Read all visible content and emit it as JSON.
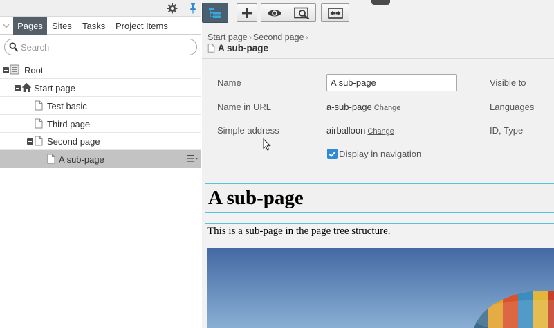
{
  "left_panel": {
    "tabs": [
      "Pages",
      "Sites",
      "Tasks",
      "Project Items"
    ],
    "search": {
      "placeholder": "Search",
      "value": ""
    },
    "tree": [
      {
        "label": "Root",
        "icon": "root-icon"
      },
      {
        "label": "Start page",
        "icon": "home-icon"
      },
      {
        "label": "Test basic",
        "icon": "page-icon"
      },
      {
        "label": "Third page",
        "icon": "page-icon"
      },
      {
        "label": "Second page",
        "icon": "page-icon"
      },
      {
        "label": "A sub-page",
        "icon": "page-icon",
        "selected": true
      }
    ]
  },
  "breadcrumb": {
    "items": [
      "Start page",
      "Second page"
    ],
    "current": "A sub-page"
  },
  "properties": {
    "name_label": "Name",
    "name_value": "A sub-page",
    "url_label": "Name in URL",
    "url_value": "a-sub-page",
    "simple_address_label": "Simple address",
    "simple_address_value": "airballoon",
    "change_label": "Change",
    "display_nav_label": "Display in navigation",
    "display_nav_checked": true,
    "visible_to_label": "Visible to",
    "languages_label": "Languages",
    "id_type_label": "ID, Type"
  },
  "content": {
    "heading": "A sub-page",
    "body": "This is a sub-page in the page tree structure."
  },
  "colors": {
    "active_tab": "#545f69",
    "toolbar_active": "#4b5f6e",
    "selected_row": "#c3c3c3",
    "accent": "#2e8ad8",
    "block_border": "#58c2e0"
  }
}
